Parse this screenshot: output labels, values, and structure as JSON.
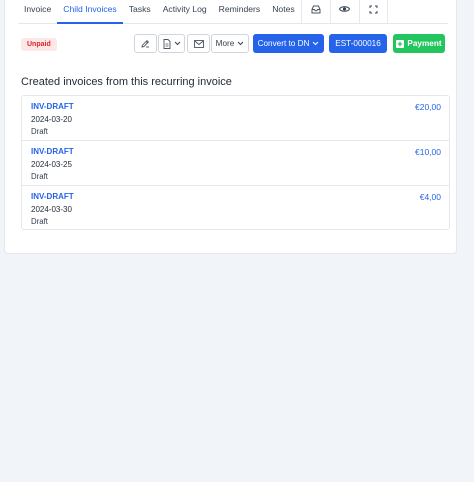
{
  "tabs": [
    {
      "label": "Invoice"
    },
    {
      "label": "Child Invoices",
      "active": true
    },
    {
      "label": "Tasks"
    },
    {
      "label": "Activity Log"
    },
    {
      "label": "Reminders"
    },
    {
      "label": "Notes"
    }
  ],
  "tab_icons": [
    "inbox-icon",
    "eye-icon",
    "expand-icon"
  ],
  "status_badge": "Unpaid",
  "toolbar": {
    "more_label": "More",
    "convert_label": "Convert to DN",
    "estimate_label": "EST-000016",
    "payment_label": "Payment"
  },
  "section_title": "Created invoices from this recurring invoice",
  "invoices": [
    {
      "number": "INV-DRAFT",
      "amount": "€20,00",
      "date": "2024-03-20",
      "status": "Draft"
    },
    {
      "number": "INV-DRAFT",
      "amount": "€10,00",
      "date": "2024-03-25",
      "status": "Draft"
    },
    {
      "number": "INV-DRAFT",
      "amount": "€4,00",
      "date": "2024-03-30",
      "status": "Draft"
    }
  ],
  "colors": {
    "accent": "#2563eb",
    "success": "#22c55e",
    "danger": "#dc2626",
    "badge_bg": "#fde8e8"
  }
}
